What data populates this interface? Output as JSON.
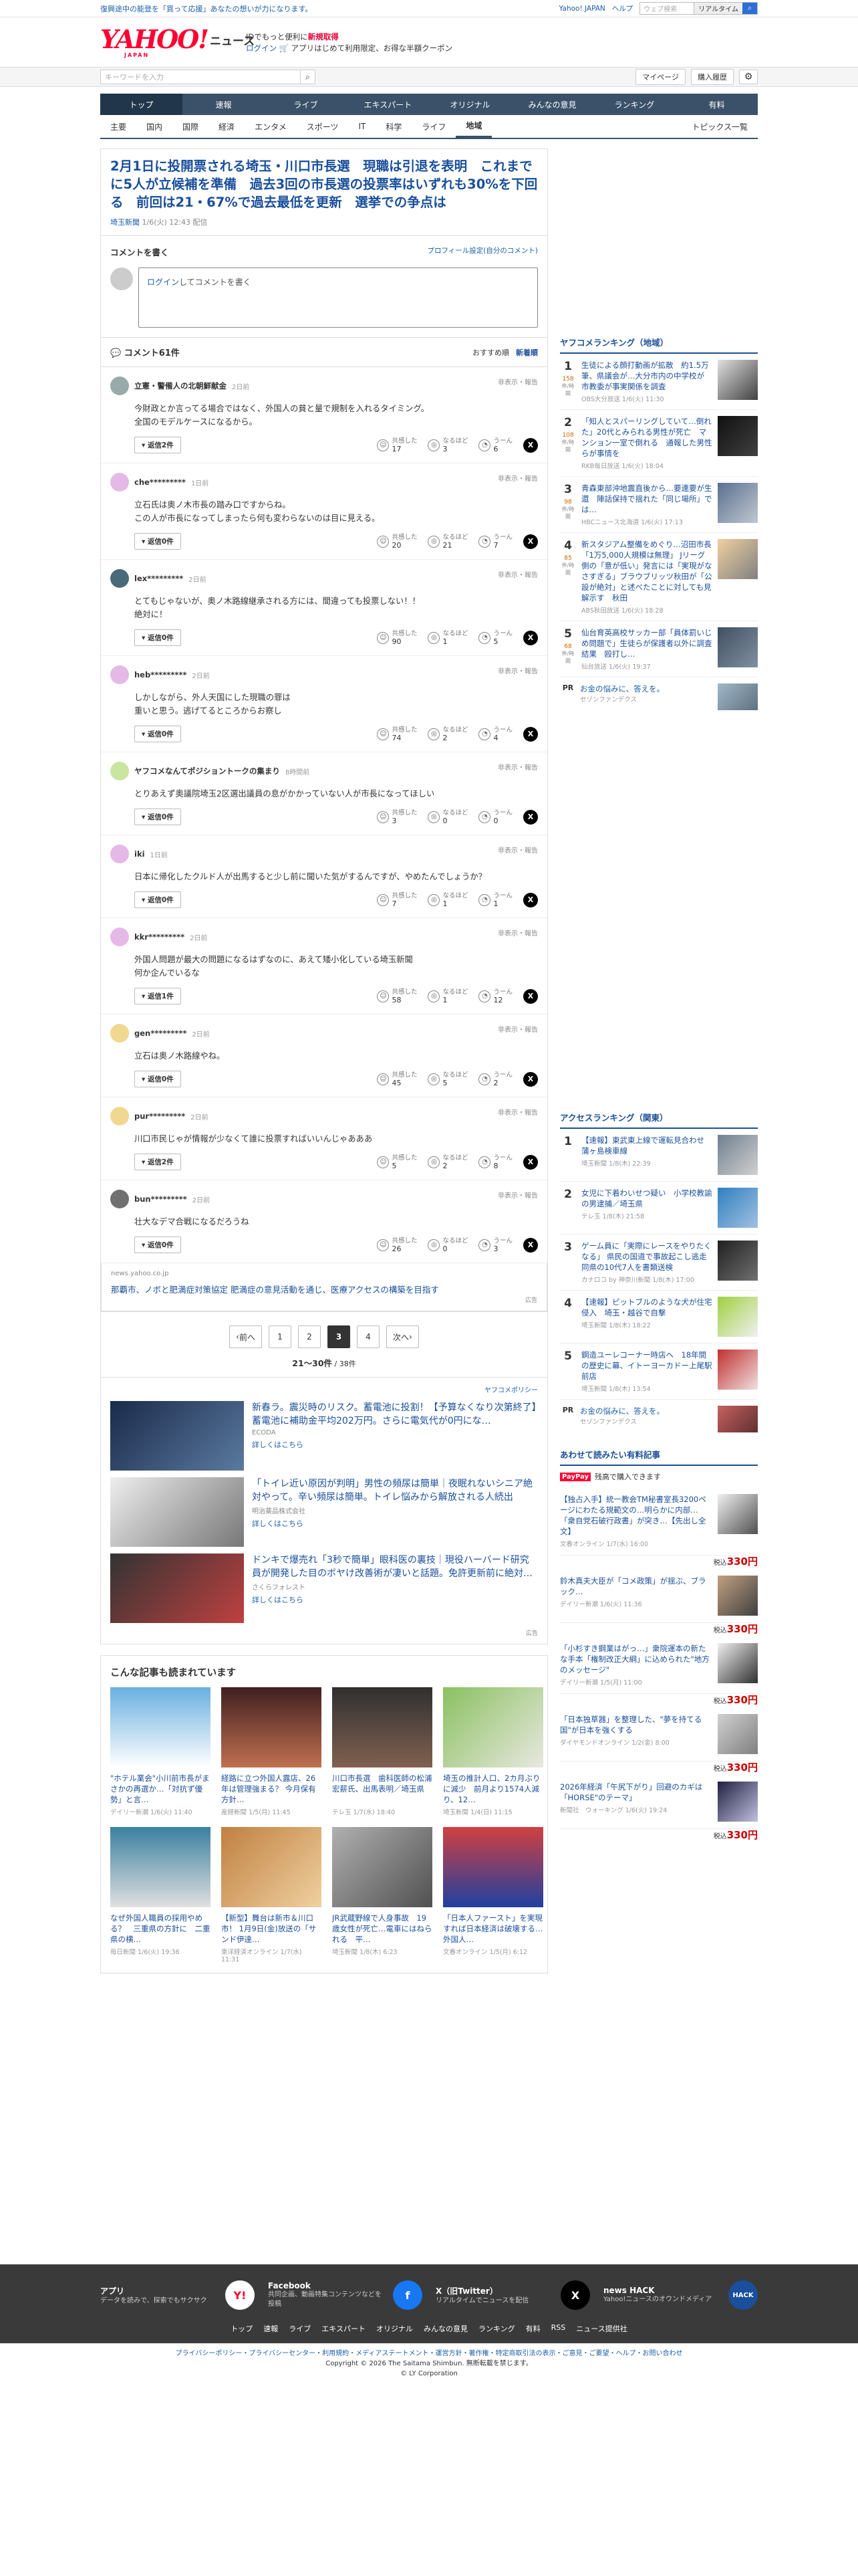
{
  "topbar": {
    "message": "復興途中の能登を「買って応援」あなたの想いが力になります。",
    "links": [
      "Yahoo! JAPAN",
      "ヘルプ"
    ],
    "search_placeholder": "ウェブ検索",
    "search_button": "リアルタイム"
  },
  "logo": {
    "brand": "YAHOO!",
    "japan": "JAPAN",
    "service": "ニュース"
  },
  "promo": {
    "line1_pre": "ID",
    "line1": "でもっと便利に",
    "line1_link": "新規取得",
    "login": "ログイン",
    "line2": "アプリはじめて利用限定、お得な半額クーポン"
  },
  "toolbar": {
    "keyword_placeholder": "キーワードを入力",
    "mypage": "マイページ",
    "history": "購入履歴"
  },
  "gnav": [
    "トップ",
    "速報",
    "ライブ",
    "エキスパート",
    "オリジナル",
    "みんなの意見",
    "ランキング",
    "有料"
  ],
  "subnav": {
    "items": [
      "主要",
      "国内",
      "国際",
      "経済",
      "エンタメ",
      "スポーツ",
      "IT",
      "科学",
      "ライフ",
      "地域"
    ],
    "active": "地域",
    "topics": "トピックス一覧"
  },
  "article": {
    "title": "2月1日に投開票される埼玉・川口市長選　現職は引退を表明　これまでに5人が立候補を準備　過去3回の市長選の投票率はいずれも30%を下回る　前回は21・67%で過去最低を更新　選挙での争点は",
    "source": "埼玉新聞",
    "time": "1/6(火) 12:43 配信"
  },
  "comment_form": {
    "title": "コメントを書く",
    "profile_link": "プロフィール設定(自分のコメント)",
    "login": "ログイン",
    "prompt": "してコメントを書く"
  },
  "comments_header": {
    "label": "コメント61件",
    "sort_rec": "おすすめ順",
    "sort_new": "新着順"
  },
  "reaction_labels": {
    "agree": "共感した",
    "hmm": "なるほど",
    "uun": "うーん",
    "report": "非表示・報告"
  },
  "comments": [
    {
      "name": "立憲・警備人の北朝鮮献金",
      "time": "2日前",
      "text": "今財政とか言ってる場合ではなく、外国人の貧と量で規制を入れるタイミング。\n全国のモデルケースになるから。",
      "replies": "返信2件",
      "agree": "17",
      "hmm": "3",
      "uun": "6",
      "color": "#9aa"
    },
    {
      "name": "che*********",
      "time": "1日前",
      "text": "立石氏は奥ノ木市長の踏み口ですからね。\nこの人が市長になってしまったら何も変わらないのは目に見える。",
      "replies": "返信0件",
      "agree": "20",
      "hmm": "21",
      "uun": "7",
      "color": "#e6b8e6"
    },
    {
      "name": "lex*********",
      "time": "2日前",
      "text": "とてもじゃないが、奥ノ木路線継承される方には、間違っても投票しない！！\n絶対に！",
      "replies": "返信0件",
      "agree": "90",
      "hmm": "1",
      "uun": "5",
      "color": "#4a6a7a"
    },
    {
      "name": "heb*********",
      "time": "2日前",
      "text": "しかしながら、外人天国にした現職の罪は\n重いと思う。逃げてるところからお察し",
      "replies": "返信0件",
      "agree": "74",
      "hmm": "2",
      "uun": "4",
      "color": "#e6b8e6"
    },
    {
      "name": "ヤフコメなんてポジショントークの集まり",
      "time": "8時間前",
      "text": "とりあえず奥議院埼玉2区選出議員の息がかかっていない人が市長になってほしい",
      "replies": "返信0件",
      "agree": "3",
      "hmm": "0",
      "uun": "0",
      "color": "#c8e6a0"
    },
    {
      "name": "iki",
      "time": "1日前",
      "text": "日本に帰化したクルド人が出馬すると少し前に聞いた気がするんですが、やめたんでしょうか？",
      "replies": "返信0件",
      "agree": "7",
      "hmm": "1",
      "uun": "1",
      "color": "#e6b8e6"
    },
    {
      "name": "kkr*********",
      "time": "2日前",
      "text": "外国人問題が最大の問題になるはずなのに、あえて矮小化している埼玉新聞\n何か企んでいるな",
      "replies": "返信1件",
      "agree": "58",
      "hmm": "1",
      "uun": "12",
      "color": "#e6b8e6"
    },
    {
      "name": "gen*********",
      "time": "2日前",
      "text": "立石は奥ノ木路線やね。",
      "replies": "返信0件",
      "agree": "45",
      "hmm": "5",
      "uun": "2",
      "color": "#f0d890"
    },
    {
      "name": "pur*********",
      "time": "2日前",
      "text": "川口市民じゃが情報が少なくて誰に投票すればいいんじゃあああ",
      "replies": "返信2件",
      "agree": "5",
      "hmm": "2",
      "uun": "8",
      "color": "#f0d890"
    },
    {
      "name": "bun*********",
      "time": "2日前",
      "text": "壮大なデマ合戦になるだろうね",
      "replies": "返信0件",
      "agree": "26",
      "hmm": "0",
      "uun": "3",
      "color": "#707070"
    }
  ],
  "inline_ad": {
    "url": "news.yahoo.co.jp",
    "text": "那覇市、ノボと肥満症対策協定 肥満症の意見活動を通じ、医療アクセスの構築を目指す",
    "badge": "広告"
  },
  "pager": {
    "prev": "前へ",
    "pages": [
      "1",
      "2",
      "3",
      "4"
    ],
    "current": "3",
    "next": "次へ",
    "info_range": "21〜30件",
    "info_total": "38件"
  },
  "ads": {
    "policy": "ヤフコメポリシー",
    "items": [
      {
        "title": "新春ラ。震災時のリスク。蓄電池に投割！【予算なくなり次第終了】蓄電池に補助金平均202万円。さらに電気代が0円にな…",
        "sponsor": "ECODA",
        "more": "詳しくはこちら"
      },
      {
        "title": "「トイレ近い原因が判明」男性の頻尿は簡単｜夜眠れないシニア絶対やって。辛い頻尿は簡単。トイレ悩みから解放される人続出",
        "sponsor": "明治薬品株式会社",
        "more": "詳しくはこちら"
      },
      {
        "title": "ドンキで爆売れ「3秒で簡単」眼科医の裏技｜現役ハーバード研究員が開発した目のボヤけ改善術が凄いと話題。免許更新前に絶対…",
        "sponsor": "さくらフォレスト",
        "more": "詳しくはこちら"
      }
    ],
    "badge": "広告"
  },
  "related": {
    "title": "こんな記事も読まれています",
    "items": [
      {
        "title": "\"ホテル業会\"小川前市長がまさかの再選か…「対抗ず優勢」と言…",
        "src": "デイリー新潮",
        "time": "1/6(火) 11:40"
      },
      {
        "title": "経路に立つ外国人露店、26年は管理強まる？ 今月保有方針…",
        "src": "産経新聞",
        "time": "1/5(月) 11:45"
      },
      {
        "title": "川口市長選　歯科医師の松浦宏薪氏、出馬表明／埼玉県",
        "src": "テレ玉",
        "time": "1/7(水) 18:40"
      },
      {
        "title": "埼玉の推計人口、2カ月ぶりに減少　前月より1574人減り、12…",
        "src": "埼玉新聞",
        "time": "1/4(日) 11:15"
      },
      {
        "title": "なぜ外国人職員の採用やめる？　三重県の方針に　二重県の横…",
        "src": "毎日新聞",
        "time": "1/6(火) 19:36"
      },
      {
        "title": "【新型】舞台は新市＆川口市！ 1月9日(金)放送の「サンド伊達…",
        "src": "東洋経済オンライン",
        "time": "1/7(水) 11:31"
      },
      {
        "title": "JR武蔵野線で人身事故　19歳女性が死亡…電車にはねられる　平…",
        "src": "埼玉新聞",
        "time": "1/8(木) 6:23"
      },
      {
        "title": "「日本人ファースト」を実現すれば日本経済は破壊する…外国人…",
        "src": "文春オンライン",
        "time": "1/5(月) 6:12"
      }
    ]
  },
  "ranking_local": {
    "title": "ヤフコメランキング（地域）",
    "unit": "件/時間",
    "items": [
      {
        "rank": "1",
        "count": "158",
        "title": "生徒による顔打動画が拡散　約1.5万筆、県議会が…大分市内の中学校が　市教委が事実関係を調査",
        "src": "OBS大分放送",
        "time": "1/6(火) 11:30"
      },
      {
        "rank": "2",
        "count": "108",
        "title": "「知人とスパーリングしていて…倒れた」20代とみられる男性が死亡　マンション一室で倒れる　通報した男性らが事情を",
        "src": "RKB毎日放送",
        "time": "1/6(火) 18:04"
      },
      {
        "rank": "3",
        "count": "98",
        "title": "青森東部沖地震直後から…要連要が生還　陣話保持で揺れた「同じ場所」では…",
        "src": "HBCニュース北海道",
        "time": "1/6(火) 17:13"
      },
      {
        "rank": "4",
        "count": "85",
        "title": "新スタジアム整備をめぐり…沼田市長「1万5,000人規模は無理」 Jリーグ側の「意が低い」発言には「実現がなさすぎる」ブラウブリッツ秋田が「公設が絶対」と述べたことに対しても見解示す　秋田",
        "src": "ABS秋田放送",
        "time": "1/6(火) 18:28"
      },
      {
        "rank": "5",
        "count": "68",
        "title": "仙台育英高校サッカー部「員体罰いじめ問題で」生徒らが保護者以外に調査結果　殴打し…",
        "src": "仙台放送",
        "time": "1/6(火) 19:37"
      }
    ],
    "pr": {
      "label": "PR",
      "title": "お金の悩みに、答えを。",
      "sponsor": "セゾンファンデクス"
    }
  },
  "ranking_access": {
    "title": "アクセスランキング（関東）",
    "items": [
      {
        "rank": "1",
        "title": "【速報】東武東上線で運転見合わせ　蒲ヶ島検車線",
        "src": "埼玉新聞",
        "time": "1/8(木) 22:39"
      },
      {
        "rank": "2",
        "title": "女児に下着わいせつ疑い　小学校教諭の男逮捕／埼玉県",
        "src": "テレ玉",
        "time": "1/8(木) 21:58"
      },
      {
        "rank": "3",
        "title": "ゲーム員に「実際にレースをやりたくなる」 県民の国道で事故起こし逃走　同県の10代7人を書類送検",
        "src": "カナロコ by 神奈川新聞",
        "time": "1/8(木) 17:00"
      },
      {
        "rank": "4",
        "title": "【速報】ピットブルのような犬が住宅侵入　埼玉・越谷で自撃",
        "src": "埼玉新聞",
        "time": "1/8(木) 18:22"
      },
      {
        "rank": "5",
        "title": "鋼造ユーレコーナー時店ヘ　18年間の歴史に幕、イトーヨーカドー上尾駅前店",
        "src": "埼玉新聞",
        "time": "1/8(木) 13:54"
      }
    ],
    "pr": {
      "label": "PR",
      "title": "お金の悩みに、答えを。",
      "sponsor": "セゾンファンデクス"
    }
  },
  "paid": {
    "title": "あわせて読みたい有料記事",
    "paypay": "PayPay",
    "paypay_text": "残高で購入できます",
    "price_label": "税込",
    "items": [
      {
        "title": "【独占入手】統一教会TM秘書室長3200ページにわたる規範文の…明らかに内部…「衆自党石破行政書」が突き…【先出し全文】",
        "src": "文春オンライン",
        "time": "1/7(水) 16:00",
        "price": "330円"
      },
      {
        "title": "鈴木真夫大臣が「コメ政策」が揺ぶ、ブラック…",
        "src": "デイリー新潮",
        "time": "1/6(火) 11:36",
        "price": "330円"
      },
      {
        "title": "「小杉すき鋼業はがっ…」衆院運本の新たな手本「権制改正大綱」に込められた\"地方のメッセージ\"",
        "src": "デイリー新潮",
        "time": "1/5(月) 11:00",
        "price": "330円"
      },
      {
        "title": "「日本独草器」を整理した、\"夢を持てる国\"が日本を強くする",
        "src": "ダイヤモンドオンライン",
        "time": "1/2(金) 8:00",
        "price": "330円"
      },
      {
        "title": "2026年経済「午尻下がり」回避のカギは「HORSE\"のテーマ」",
        "src": "新聞社　ウォーキング",
        "time": "1/6(火) 19:24",
        "price": "330円"
      }
    ]
  },
  "footer": {
    "apps": [
      {
        "title": "アプリ",
        "desc": "データを読みで、探索でもサクサク",
        "icon": "Y!"
      },
      {
        "title": "Facebook",
        "desc": "共同企画、動画特集コンテンツなどを投稿",
        "icon": "f"
      },
      {
        "title": "X（旧Twitter）",
        "desc": "リアルタイムでニュースを配信",
        "icon": "X"
      },
      {
        "title": "news HACK",
        "desc": "Yahoo!ニュースのオウンドメディア",
        "icon": "HACK"
      }
    ],
    "links": [
      "トップ",
      "速報",
      "ライブ",
      "エキスパート",
      "オリジナル",
      "みんなの意見",
      "ランキング",
      "有料",
      "RSS",
      "ニュース提供社"
    ],
    "legal": "プライバシーポリシー・プライバシーセンター・利用規約・メディアステートメント・運営方針・著作権・特定商取引法の表示・ご意見・ご要望・ヘルプ・お問い合わせ",
    "copyright": "Copyright © 2026 The Saitama Shimbun. 無断転載を禁じます。",
    "corp": "© LY Corporation"
  }
}
